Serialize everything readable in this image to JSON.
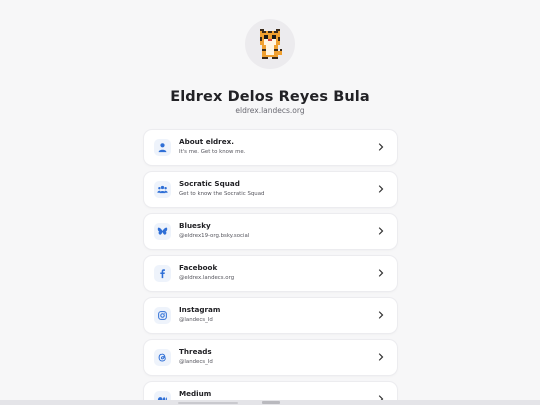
{
  "profile": {
    "avatar_icon": "pixel-tiger-avatar",
    "name": "Eldrex Delos Reyes Bula",
    "site": "eldrex.landecs.org"
  },
  "accent_color": "#2f6fd6",
  "links": [
    {
      "icon": "user-icon",
      "title": "About eldrex.",
      "subtitle": "It's me. Get to know me."
    },
    {
      "icon": "group-icon",
      "title": "Socratic Squad",
      "subtitle": "Get to know the Socratic Squad"
    },
    {
      "icon": "bluesky-butterfly-icon",
      "title": "Bluesky",
      "subtitle": "@eldrex19-org.bsky.social"
    },
    {
      "icon": "facebook-icon",
      "title": "Facebook",
      "subtitle": "@eldrex.landecs.org"
    },
    {
      "icon": "instagram-icon",
      "title": "Instagram",
      "subtitle": "@landecs_Id"
    },
    {
      "icon": "threads-icon",
      "title": "Threads",
      "subtitle": "@landecs_Id"
    },
    {
      "icon": "medium-icon",
      "title": "Medium",
      "subtitle": ""
    }
  ]
}
